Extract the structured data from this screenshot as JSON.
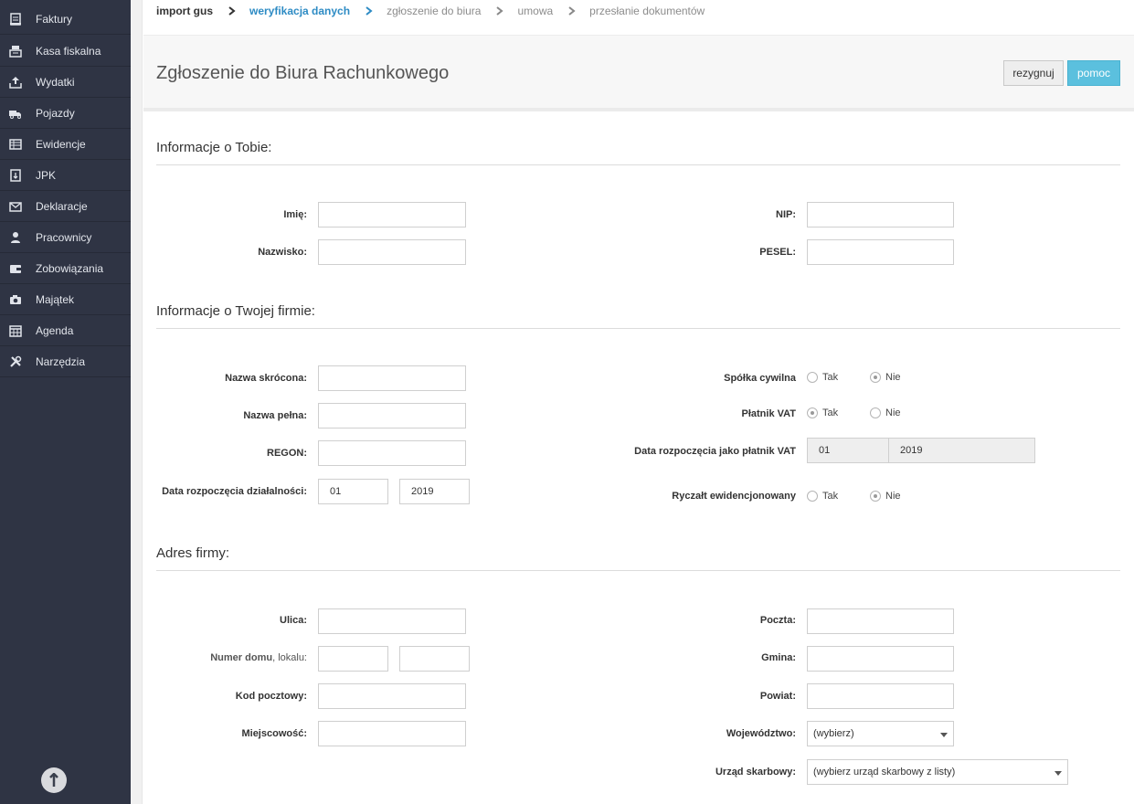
{
  "sidebar": {
    "items": [
      {
        "label": "Faktury",
        "icon": "invoice-icon"
      },
      {
        "label": "Kasa fiskalna",
        "icon": "cash-register-icon"
      },
      {
        "label": "Wydatki",
        "icon": "upload-icon"
      },
      {
        "label": "Pojazdy",
        "icon": "truck-icon"
      },
      {
        "label": "Ewidencje",
        "icon": "list-icon"
      },
      {
        "label": "JPK",
        "icon": "document-arrow-icon"
      },
      {
        "label": "Deklaracje",
        "icon": "envelope-icon"
      },
      {
        "label": "Pracownicy",
        "icon": "person-icon"
      },
      {
        "label": "Zobowiązania",
        "icon": "wallet-icon"
      },
      {
        "label": "Majątek",
        "icon": "camera-icon"
      },
      {
        "label": "Agenda",
        "icon": "calendar-icon"
      },
      {
        "label": "Narzędzia",
        "icon": "tools-icon"
      }
    ]
  },
  "breadcrumb": {
    "steps": [
      "import gus",
      "weryfikacja danych",
      "zgłoszenie do biura",
      "umowa",
      "przesłanie dokumentów"
    ],
    "active_index": 1
  },
  "header": {
    "title": "Zgłoszenie do Biura Rachunkowego",
    "cancel_label": "rezygnuj",
    "help_label": "pomoc"
  },
  "sections": {
    "about_you": "Informacje o Tobie:",
    "company": "Informacje o Twojej firmie:",
    "address": "Adres firmy:"
  },
  "about_you": {
    "first_name_label": "Imię:",
    "last_name_label": "Nazwisko:",
    "nip_label": "NIP:",
    "pesel_label": "PESEL:",
    "first_name": "",
    "last_name": "",
    "nip": "",
    "pesel": ""
  },
  "company": {
    "short_name_label": "Nazwa skrócona:",
    "full_name_label": "Nazwa pełna:",
    "regon_label": "REGON:",
    "start_date_label": "Data rozpoczęcia działalności:",
    "start_month": "01",
    "start_year": "2019",
    "civil_partnership_label": "Spółka cywilna",
    "vat_payer_label": "Płatnik VAT",
    "vat_start_label": "Data rozpoczęcia jako płatnik VAT",
    "vat_start_month": "01",
    "vat_start_year": "2019",
    "lump_sum_label": "Ryczałt ewidencjonowany",
    "yes": "Tak",
    "no": "Nie",
    "civil_partnership": "Nie",
    "vat_payer": "Tak",
    "lump_sum": "Nie"
  },
  "address": {
    "street_label": "Ulica:",
    "house_label_bold": "Numer domu",
    "house_label_rest": ", lokalu:",
    "postal_code_label": "Kod pocztowy:",
    "city_label": "Miejscowość:",
    "post_office_label": "Poczta:",
    "commune_label": "Gmina:",
    "county_label": "Powiat:",
    "voivodeship_label": "Województwo:",
    "voivodeship_value": "(wybierz)",
    "tax_office_label": "Urząd skarbowy:",
    "tax_office_value": "(wybierz urząd skarbowy z listy)"
  },
  "colors": {
    "sidebar_bg": "#2f3444",
    "accent": "#2d8bc4",
    "help_button": "#5bc0de"
  }
}
